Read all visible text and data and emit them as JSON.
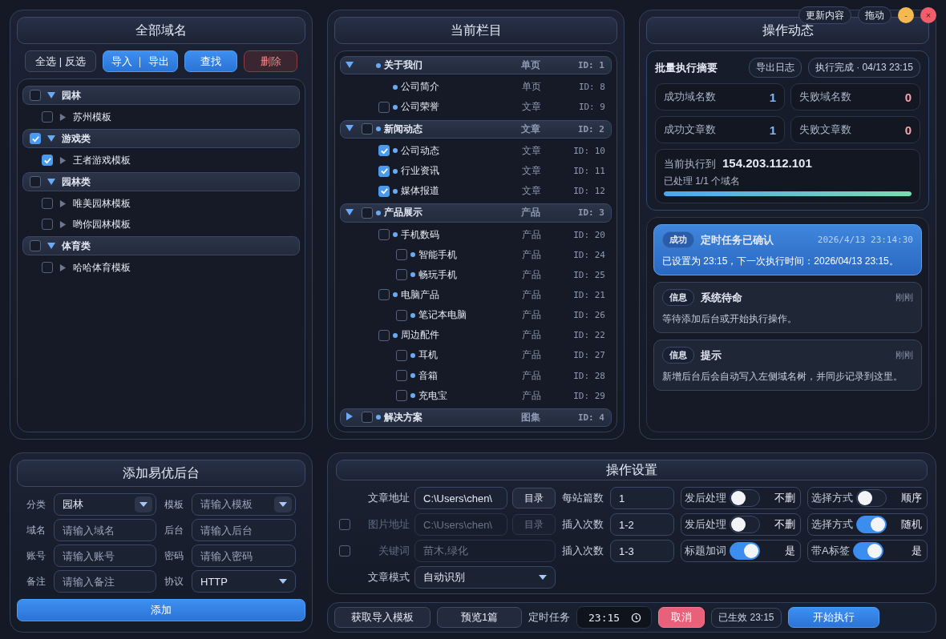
{
  "window_controls": {
    "buttons": [
      "更新内容",
      "拖动"
    ],
    "minimize": "-",
    "close": "×"
  },
  "domains": {
    "title": "全部域名",
    "buttons": [
      {
        "label": "全选 | 反选",
        "kind": "default"
      },
      {
        "label": "导入 ｜ 导出",
        "kind": "primary"
      },
      {
        "label": "查找",
        "kind": "primary"
      },
      {
        "label": "删除",
        "kind": "danger"
      }
    ],
    "groups": [
      {
        "name": "园林",
        "checked": false,
        "expanded": true,
        "children": [
          {
            "name": "苏州模板",
            "checked": false,
            "expanded": false
          }
        ]
      },
      {
        "name": "游戏类",
        "checked": true,
        "expanded": true,
        "children": [
          {
            "name": "王者游戏模板",
            "checked": true,
            "expanded": false
          }
        ]
      },
      {
        "name": "园林类",
        "checked": false,
        "expanded": true,
        "children": [
          {
            "name": "唯美园林模板",
            "checked": false,
            "expanded": false
          },
          {
            "name": "哟你园林模板",
            "checked": false,
            "expanded": false
          }
        ]
      },
      {
        "name": "体育类",
        "checked": false,
        "expanded": true,
        "children": [
          {
            "name": "哈哈体育模板",
            "checked": false,
            "expanded": false
          }
        ]
      }
    ]
  },
  "columns": {
    "title": "当前栏目",
    "items": [
      {
        "name": "关于我们",
        "type": "单页",
        "id": "ID: 1",
        "expanded": true,
        "children": [
          {
            "name": "公司简介",
            "type": "单页",
            "id": "ID: 8"
          },
          {
            "name": "公司荣誉",
            "type": "文章",
            "id": "ID: 9",
            "checked": false
          }
        ]
      },
      {
        "name": "新闻动态",
        "type": "文章",
        "id": "ID: 2",
        "expanded": true,
        "checked": false,
        "children": [
          {
            "name": "公司动态",
            "type": "文章",
            "id": "ID: 10",
            "checked": true
          },
          {
            "name": "行业资讯",
            "type": "文章",
            "id": "ID: 11",
            "checked": true
          },
          {
            "name": "媒体报道",
            "type": "文章",
            "id": "ID: 12",
            "checked": true
          }
        ]
      },
      {
        "name": "产品展示",
        "type": "产品",
        "id": "ID: 3",
        "expanded": true,
        "checked": false,
        "children": [
          {
            "name": "手机数码",
            "type": "产品",
            "id": "ID: 20",
            "checked": false,
            "children": [
              {
                "name": "智能手机",
                "type": "产品",
                "id": "ID: 24",
                "checked": false
              },
              {
                "name": "畅玩手机",
                "type": "产品",
                "id": "ID: 25",
                "checked": false
              }
            ]
          },
          {
            "name": "电脑产品",
            "type": "产品",
            "id": "ID: 21",
            "checked": false,
            "children": [
              {
                "name": "笔记本电脑",
                "type": "产品",
                "id": "ID: 26",
                "checked": false
              }
            ]
          },
          {
            "name": "周边配件",
            "type": "产品",
            "id": "ID: 22",
            "checked": false,
            "children": [
              {
                "name": "耳机",
                "type": "产品",
                "id": "ID: 27",
                "checked": false
              },
              {
                "name": "音箱",
                "type": "产品",
                "id": "ID: 28",
                "checked": false
              },
              {
                "name": "充电宝",
                "type": "产品",
                "id": "ID: 29",
                "checked": false
              }
            ]
          }
        ]
      },
      {
        "name": "解决方案",
        "type": "图集",
        "id": "ID: 4",
        "expanded": false,
        "checked": false
      }
    ]
  },
  "activity": {
    "title": "操作动态",
    "summary": {
      "title": "批量执行摘要",
      "export_button": "导出日志",
      "status": "执行完成 · 04/13 23:15",
      "stats": [
        {
          "label": "成功域名数",
          "value": "1",
          "kind": "success"
        },
        {
          "label": "失败域名数",
          "value": "0",
          "kind": "fail"
        },
        {
          "label": "成功文章数",
          "value": "1",
          "kind": "success"
        },
        {
          "label": "失败文章数",
          "value": "0",
          "kind": "fail"
        }
      ],
      "current_label": "当前执行到",
      "current_value": "154.203.112.101",
      "processed": "已处理 1/1 个域名",
      "level": 1
    },
    "messages": [
      {
        "kind": "success",
        "tag": "成功",
        "title": "定时任务已确认",
        "time": "2026/4/13 23:14:30",
        "body": "已设置为 23:15，下一次执行时间：2026/04/13 23:15。"
      },
      {
        "kind": "info",
        "tag": "信息",
        "title": "系统待命",
        "time": "刚刚",
        "body": "等待添加后台或开始执行操作。"
      },
      {
        "kind": "info",
        "tag": "信息",
        "title": "提示",
        "time": "刚刚",
        "body": "新增后台后会自动写入左侧域名树，并同步记录到这里。"
      }
    ]
  },
  "add_backend": {
    "title": "添加易优后台",
    "fields": [
      {
        "label": "分类",
        "kind": "combo",
        "value": "园林"
      },
      {
        "label": "模板",
        "kind": "combo",
        "placeholder": "请输入模板"
      },
      {
        "label": "域名",
        "kind": "input",
        "placeholder": "请输入域名"
      },
      {
        "label": "后台",
        "kind": "input",
        "placeholder": "请输入后台"
      },
      {
        "label": "账号",
        "kind": "input",
        "placeholder": "请输入账号"
      },
      {
        "label": "密码",
        "kind": "input",
        "placeholder": "请输入密码"
      },
      {
        "label": "备注",
        "kind": "input",
        "placeholder": "请输入备注"
      },
      {
        "label": "协议",
        "kind": "select",
        "value": "HTTP"
      }
    ],
    "submit": "添加"
  },
  "settings": {
    "title": "操作设置",
    "paths": [
      {
        "kind": "path",
        "label": "文章地址",
        "value": "C:\\Users\\chen\\",
        "button": "目录",
        "disabled": false
      },
      {
        "kind": "path",
        "label": "图片地址",
        "value": "C:\\Users\\chen\\",
        "button": "目录",
        "disabled": true,
        "checked": false
      },
      {
        "kind": "text",
        "label": "关键词",
        "value": "苗木,绿化",
        "disabled": true,
        "checked": false
      },
      {
        "kind": "select",
        "label": "文章模式",
        "value": "自动识别",
        "disabled": false
      }
    ],
    "counts": [
      {
        "label": "每站篇数",
        "value": "1"
      },
      {
        "label": "插入次数",
        "value": "1-2"
      },
      {
        "label": "插入次数",
        "value": "1-3"
      }
    ],
    "toggles": [
      {
        "label": "发后处理",
        "on": false,
        "text": "不删"
      },
      {
        "label": "选择方式",
        "on": false,
        "text": "顺序"
      },
      {
        "label": "发后处理",
        "on": false,
        "text": "不删"
      },
      {
        "label": "选择方式",
        "on": true,
        "text": "随机"
      },
      {
        "label": "标题加词",
        "on": true,
        "text": "是"
      },
      {
        "label": "带A标签",
        "on": true,
        "text": "是"
      }
    ]
  },
  "footer": {
    "template_button": "获取导入模板",
    "preview_button": "预览1篇",
    "schedule_label": "定时任务",
    "time": "23:15",
    "cancel_button": "取消",
    "status": "已生效 23:15",
    "start_button": "开始执行"
  }
}
